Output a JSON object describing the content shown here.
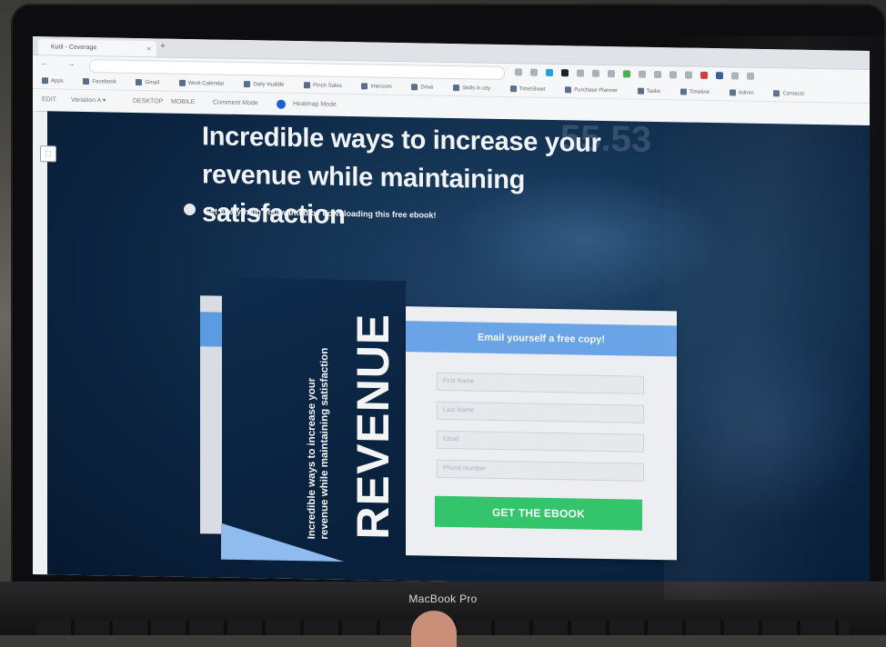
{
  "browser": {
    "tab_title": "Kutil - Coverage",
    "new_tab_symbol": "+",
    "nav_symbols": "← → ⟳",
    "bookmarks": [
      "Apps",
      "Facebook",
      "Gmail",
      "Work Calendar",
      "Daily Huddle",
      "Pinch Sales",
      "Intercom",
      "Drive",
      "Skills in city",
      "TimeSheet",
      "Purchase Planner",
      "Tasks",
      "Timeline",
      "Admin",
      "Contacts"
    ]
  },
  "editor_toolbar": {
    "edit": "EDIT",
    "variation": "Variation A",
    "variation_chevron": "▾",
    "desktop": "DESKTOP",
    "mobile": "MOBILE",
    "comment_mode": "Comment Mode",
    "heatmap_mode": "Heatmap Mode",
    "side_icon": "⬚"
  },
  "landing": {
    "headline_line1": "Incredible ways to increase your",
    "headline_line2": "revenue while maintaining satisfaction",
    "subline": "Get everything you wanted by downloading this free ebook!",
    "bg_digits": "55.53"
  },
  "ebook": {
    "word": "REVENUE",
    "line1": "Incredible ways to increase your",
    "line2": "revenue while maintaining satisfaction"
  },
  "form": {
    "title": "Email yourself a free copy!",
    "first_name_placeholder": "First Name",
    "last_name_placeholder": "Last Name",
    "email_placeholder": "Email",
    "phone_placeholder": "Phone Number",
    "cta": "GET THE EBOOK"
  },
  "laptop": {
    "brand": "MacBook Pro"
  },
  "colors": {
    "form_header": "#6aa4e6",
    "cta_green": "#34c46b",
    "page_bg": "#0b2441"
  }
}
